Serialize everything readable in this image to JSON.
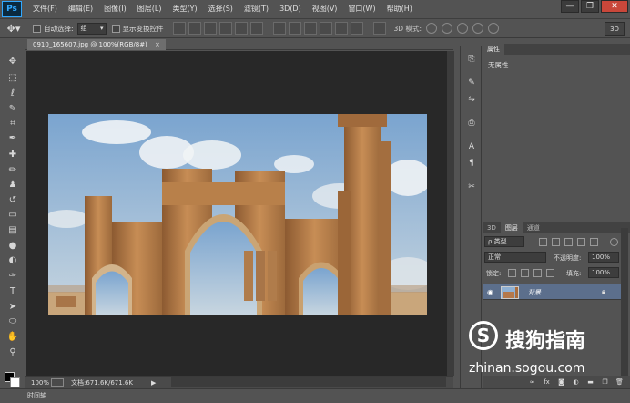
{
  "app": {
    "logo": "Ps"
  },
  "menu": [
    "文件(F)",
    "编辑(E)",
    "图像(I)",
    "图层(L)",
    "类型(Y)",
    "选择(S)",
    "滤镜(T)",
    "3D(D)",
    "视图(V)",
    "窗口(W)",
    "帮助(H)"
  ],
  "window_controls": {
    "minimize": "—",
    "restore": "❐",
    "close": "✕"
  },
  "options": {
    "auto_select_label": "自动选择:",
    "auto_select_value": "组",
    "show_transform_label": "显示变换控件",
    "mode3d_label": "3D 模式:",
    "btn3d": "3D"
  },
  "document": {
    "tab_title": "0910_165607.jpg @ 100%(RGB/8#)",
    "close": "×",
    "zoom": "100%",
    "doc_info": "文档:671.6K/671.6K"
  },
  "panels": {
    "properties_tab": "属性",
    "properties_body": "无属性",
    "layers_tabs": [
      "3D",
      "图层",
      "通道"
    ],
    "filter_kind": "ρ 类型",
    "blend_mode": "正常",
    "opacity_label": "不透明度:",
    "opacity_value": "100%",
    "lock_label": "锁定:",
    "fill_label": "填充:",
    "fill_value": "100%",
    "layer_name": "背景"
  },
  "timeline": {
    "label": "时间轴"
  },
  "watermark": {
    "logo": "S",
    "name": "搜狗指南",
    "url": "zhinan.sogou.com"
  },
  "colors": {
    "ui_bg": "#535353",
    "canvas_bg": "#282828",
    "layer_selected": "#5c6f8c",
    "ps_blue": "#31a8ff"
  },
  "tools": [
    "move-icon",
    "marquee-icon",
    "lasso-icon",
    "quick-select-icon",
    "crop-icon",
    "eyedropper-icon",
    "healing-brush-icon",
    "brush-icon",
    "clone-stamp-icon",
    "history-brush-icon",
    "eraser-icon",
    "gradient-icon",
    "blur-icon",
    "dodge-icon",
    "pen-icon",
    "type-icon",
    "path-select-icon",
    "shape-icon",
    "hand-icon",
    "zoom-icon"
  ]
}
